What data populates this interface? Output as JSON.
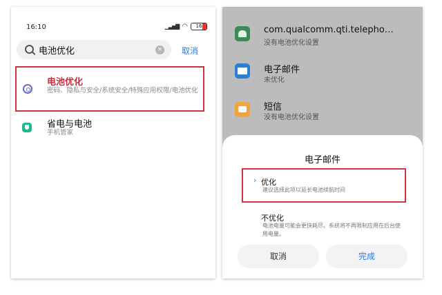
{
  "left": {
    "status": {
      "time": "16:10",
      "battery": "16"
    },
    "search": {
      "query": "电池优化",
      "cancel_label": "取消"
    },
    "results": [
      {
        "title": "电池优化",
        "subtitle": "密码、隐私与安全/系统安全/特殊应用权限/电池优化"
      },
      {
        "title": "省电与电池",
        "subtitle": "手机管家"
      }
    ]
  },
  "right": {
    "apps": [
      {
        "name": "com.qualcomm.qti.telepho…",
        "status": "没有电池优化设置",
        "icon": "android-icon"
      },
      {
        "name": "电子邮件",
        "status": "未优化",
        "icon": "mail-icon"
      },
      {
        "name": "短信",
        "status": "没有电池优化设置",
        "icon": "sms-icon"
      }
    ],
    "sheet": {
      "title": "电子邮件",
      "options": [
        {
          "title": "优化",
          "subtitle": "建议选择此项以延长电池续航时间",
          "selected": true
        },
        {
          "title": "不优化",
          "subtitle": "电池电量可能会更快耗尽。系统将不再限制应用在后台使用电量。",
          "selected": false
        }
      ],
      "cancel_label": "取消",
      "done_label": "完成"
    }
  },
  "colors": {
    "accent_blue": "#2d7be0",
    "highlight_red": "#c82b3a"
  }
}
